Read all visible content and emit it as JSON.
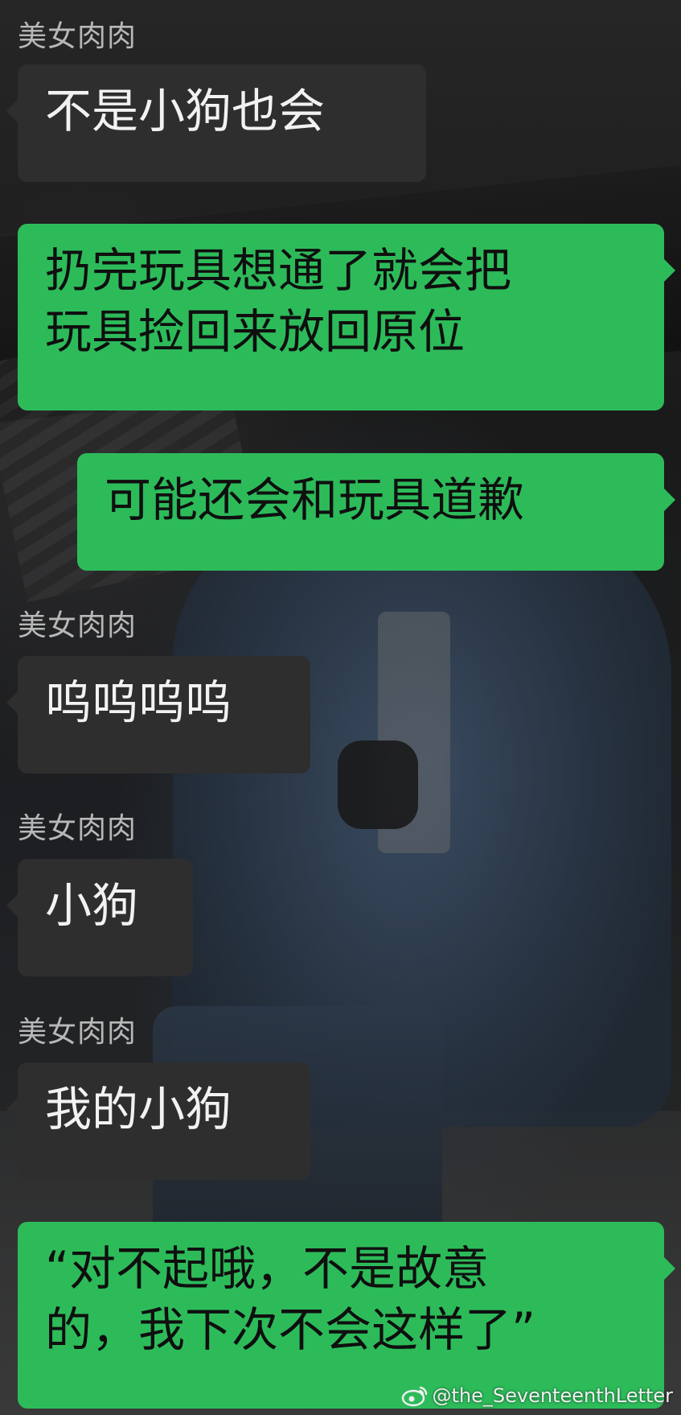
{
  "messages": [
    {
      "sender": "美女肉肉",
      "text": "不是小狗也会"
    },
    {
      "text": "扔完玩具想通了就会把\n玩具捡回来放回原位"
    },
    {
      "text": "可能还会和玩具道歉"
    },
    {
      "sender": "美女肉肉",
      "text": "呜呜呜呜"
    },
    {
      "sender": "美女肉肉",
      "text": "小狗"
    },
    {
      "sender": "美女肉肉",
      "text": "我的小狗"
    },
    {
      "text": "“对不起哦，不是故意\n的，我下次不会这样了”"
    }
  ],
  "watermark": {
    "handle": "@the_SeventeenthLetter",
    "icon": "weibo-icon"
  },
  "colors": {
    "outgoing_bubble": "#2dbb5a",
    "incoming_bubble": "#2e2e2e",
    "sender_label": "#b8b8b8"
  }
}
